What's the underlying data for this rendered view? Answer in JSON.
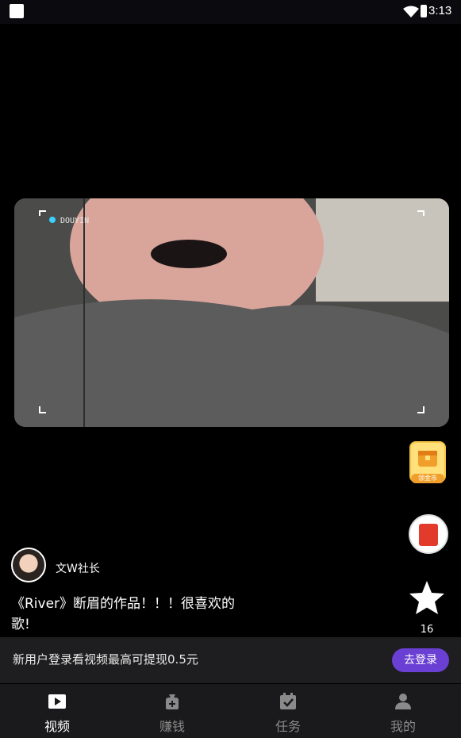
{
  "status": {
    "time": "3:13"
  },
  "video": {
    "author": "文W社长",
    "description": "《River》断眉的作品！！！很喜欢的歌!",
    "like_count": "16",
    "coin_label": "领金币"
  },
  "login_banner": {
    "text": "新用户登录看视频最高可提现0.5元",
    "button": "去登录"
  },
  "nav": {
    "items": [
      {
        "label": "视频",
        "icon": "play-icon",
        "active": true
      },
      {
        "label": "赚钱",
        "icon": "money-bag-icon",
        "active": false
      },
      {
        "label": "任务",
        "icon": "calendar-check-icon",
        "active": false
      },
      {
        "label": "我的",
        "icon": "user-icon",
        "active": false
      }
    ]
  },
  "colors": {
    "accent": "#6a3fd3",
    "nav_active": "#ffffff",
    "nav_inactive": "#8a8a8a"
  }
}
